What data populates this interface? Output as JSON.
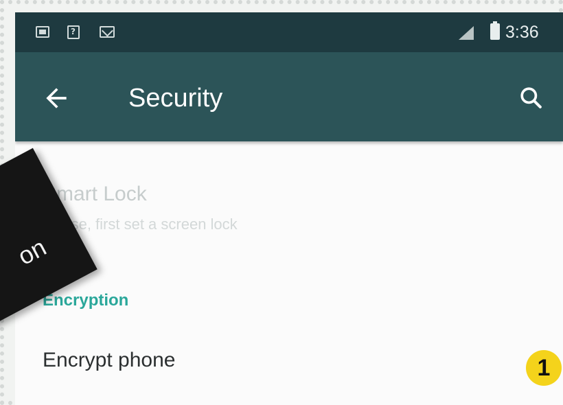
{
  "status_bar": {
    "icons": [
      "image-icon",
      "sim-icon",
      "mail-icon",
      "signal-icon",
      "battery-icon"
    ],
    "time": "3:36"
  },
  "toolbar": {
    "title": "Security",
    "background": "#2c5458"
  },
  "settings": {
    "smart_lock": {
      "title": "Smart Lock",
      "summary": "To use, first set a screen lock"
    },
    "category_encryption": "Encryption",
    "encrypt_phone": {
      "title": "Encrypt phone"
    }
  },
  "annotations": {
    "overlay_label": "on",
    "step_badge": "1"
  },
  "colors": {
    "status_bar": "#1e3a40",
    "accent": "#2aa79a",
    "badge": "#f4d31b"
  }
}
